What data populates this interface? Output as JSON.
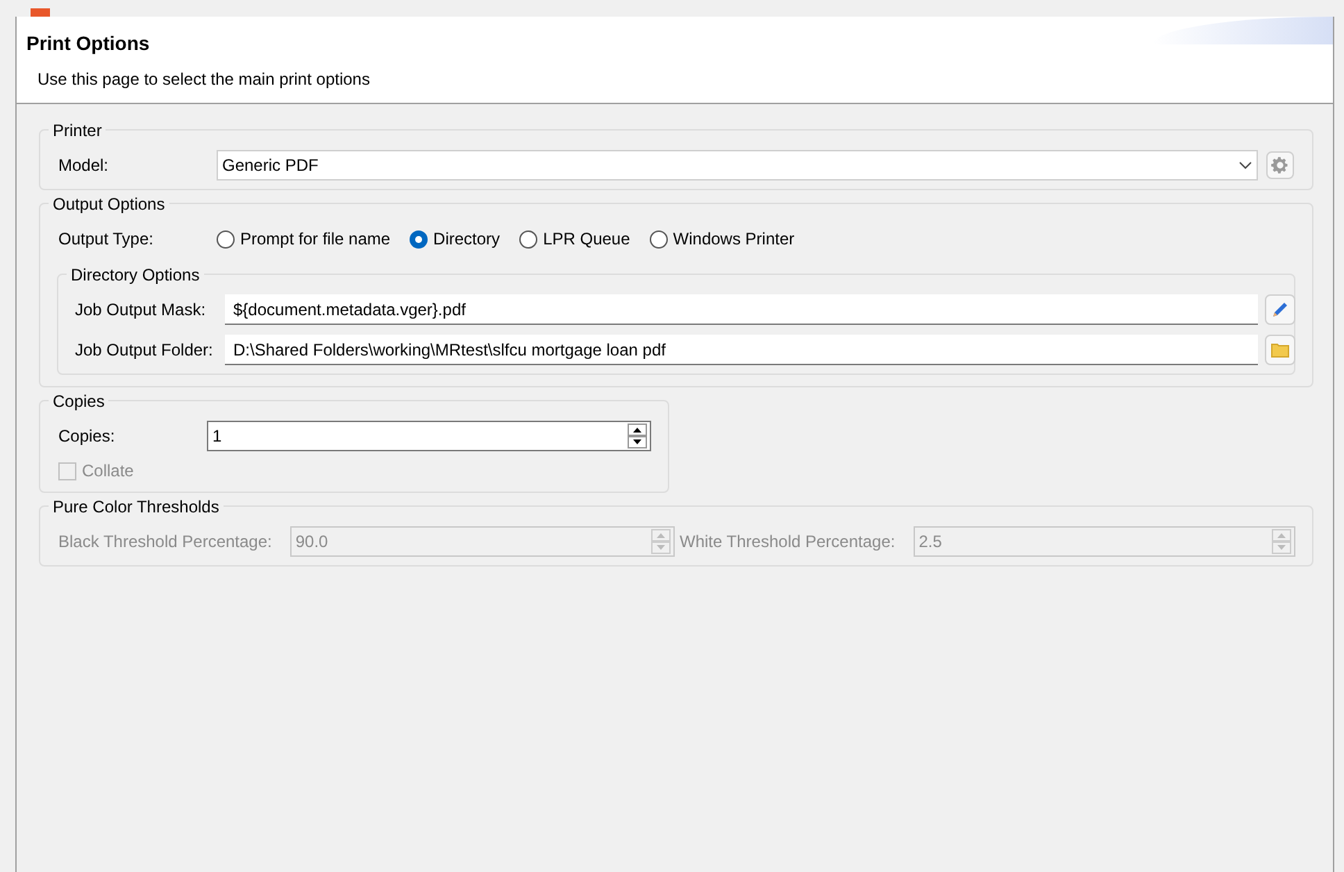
{
  "header": {
    "title": "Print Options",
    "description": "Use this page to select the main print options"
  },
  "printer": {
    "legend": "Printer",
    "model_label": "Model:",
    "model_value": "Generic PDF"
  },
  "output_options": {
    "legend": "Output Options",
    "type_label": "Output Type:",
    "types": [
      {
        "label": "Prompt for file name",
        "selected": false
      },
      {
        "label": "Directory",
        "selected": true
      },
      {
        "label": "LPR Queue",
        "selected": false
      },
      {
        "label": "Windows Printer",
        "selected": false
      }
    ],
    "directory_options": {
      "legend": "Directory Options",
      "fields": [
        {
          "label": "Job Output Mask:",
          "value": "${document.metadata.vger}.pdf",
          "kind": "edit"
        },
        {
          "label": "Job Output Folder:",
          "value": "D:\\Shared Folders\\working\\MRtest\\slfcu mortgage loan pdf",
          "kind": "browse"
        }
      ]
    }
  },
  "copies": {
    "legend": "Copies",
    "copies_label": "Copies:",
    "copies_value": "1",
    "collate": {
      "label": "Collate",
      "checked": false,
      "disabled": true
    }
  },
  "thresholds": {
    "legend": "Pure Color Thresholds",
    "disabled": true,
    "fields": [
      {
        "label": "Black Threshold Percentage:",
        "value": "90.0"
      },
      {
        "label": "White Threshold Percentage:",
        "value": "2.5"
      }
    ]
  }
}
